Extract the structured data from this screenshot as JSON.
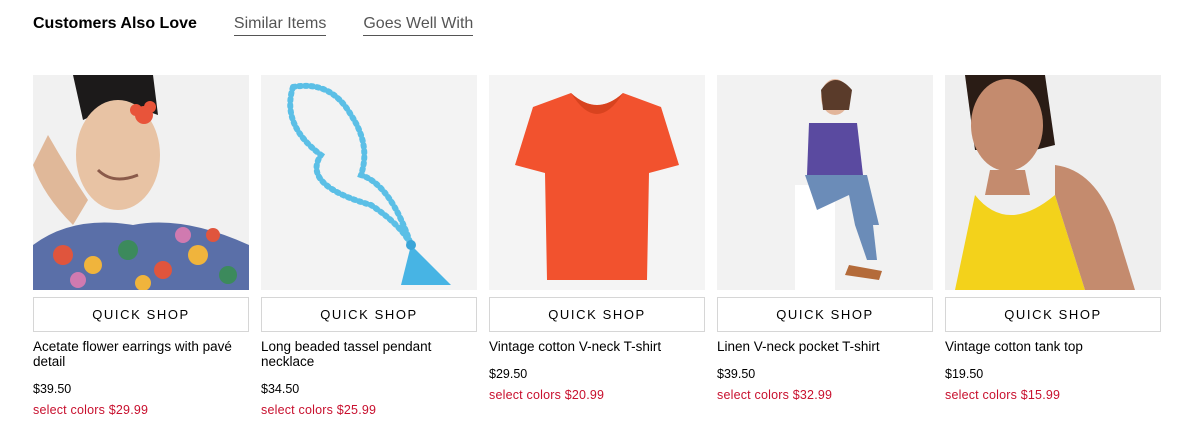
{
  "tabs": {
    "active": "Customers Also Love",
    "similar": "Similar Items",
    "goes_well": "Goes Well With"
  },
  "products": [
    {
      "quick_shop": "QUICK SHOP",
      "name": "Acetate flower earrings with pavé detail",
      "price": "$39.50",
      "sale": "select colors $29.99",
      "image": "woman-floral-blouse-photo"
    },
    {
      "quick_shop": "QUICK SHOP",
      "name": "Long beaded tassel pendant necklace",
      "price": "$34.50",
      "sale": "select colors $25.99",
      "image": "turquoise-bead-necklace-photo"
    },
    {
      "quick_shop": "QUICK SHOP",
      "name": "Vintage cotton V-neck T-shirt",
      "price": "$29.50",
      "sale": "select colors $20.99",
      "image": "orange-tshirt-photo"
    },
    {
      "quick_shop": "QUICK SHOP",
      "name": "Linen V-neck pocket T-shirt",
      "price": "$39.50",
      "sale": "select colors $32.99",
      "image": "seated-woman-purple-tee-photo"
    },
    {
      "quick_shop": "QUICK SHOP",
      "name": "Vintage cotton tank top",
      "price": "$19.50",
      "sale": "select colors $15.99",
      "image": "woman-yellow-tank-photo"
    }
  ],
  "colors": {
    "sale_red": "#c8102e",
    "tab_gray": "#555555"
  }
}
